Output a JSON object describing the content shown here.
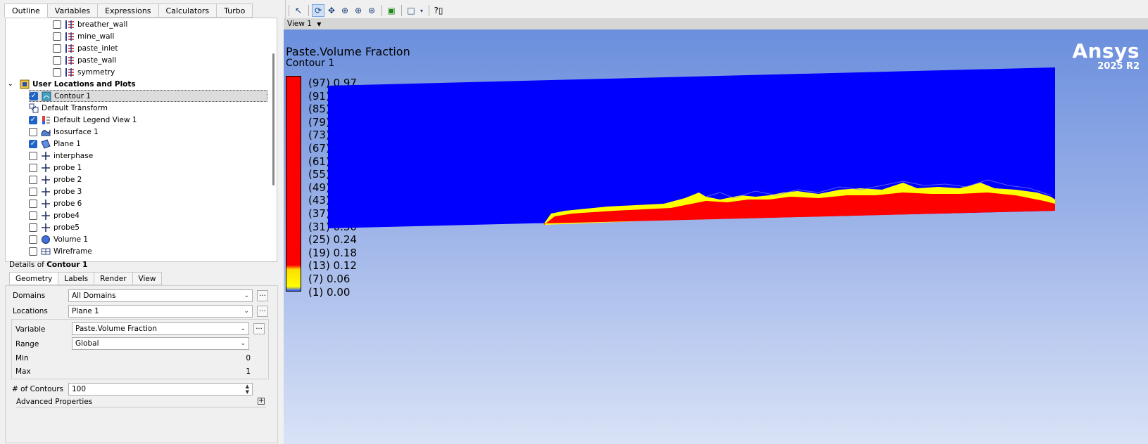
{
  "outline_tabs": [
    "Outline",
    "Variables",
    "Expressions",
    "Calculators",
    "Turbo"
  ],
  "tree": {
    "boundaries": [
      "breather_wall",
      "mine_wall",
      "paste_inlet",
      "paste_wall",
      "symmetry"
    ],
    "group_label": "User Locations and Plots",
    "items": [
      {
        "label": "Contour 1",
        "checked": true
      },
      {
        "label": "Default Transform",
        "checked": null
      },
      {
        "label": "Default Legend View 1",
        "checked": true
      },
      {
        "label": "Isosurface 1",
        "checked": false
      },
      {
        "label": "Plane 1",
        "checked": true
      },
      {
        "label": "interphase",
        "checked": false
      },
      {
        "label": "probe 1",
        "checked": false
      },
      {
        "label": "probe 2",
        "checked": false
      },
      {
        "label": "probe 3",
        "checked": false
      },
      {
        "label": "probe 6",
        "checked": false
      },
      {
        "label": "probe4",
        "checked": false
      },
      {
        "label": "probe5",
        "checked": false
      },
      {
        "label": "Volume 1",
        "checked": false
      },
      {
        "label": "Wireframe",
        "checked": false
      }
    ]
  },
  "details": {
    "title_prefix": "Details of",
    "title_object": "Contour 1",
    "tabs": [
      "Geometry",
      "Labels",
      "Render",
      "View"
    ],
    "domains_label": "Domains",
    "domains_value": "All Domains",
    "locations_label": "Locations",
    "locations_value": "Plane 1",
    "variable_label": "Variable",
    "variable_value": "Paste.Volume Fraction",
    "range_label": "Range",
    "range_value": "Global",
    "min_label": "Min",
    "min_value": "0",
    "max_label": "Max",
    "max_value": "1",
    "contours_label": "# of Contours",
    "contours_value": "100",
    "advanced_label": "Advanced Properties",
    "dots": "..."
  },
  "viewer": {
    "view_label": "View 1",
    "title": "Paste.Volume Fraction",
    "subtitle": "Contour 1",
    "legend": [
      "(97) 0.97",
      "(91) 0.91",
      "(85) 0.85",
      "(79) 0.79",
      "(73) 0.73",
      "(67) 0.67",
      "(61) 0.61",
      "(55) 0.55",
      "(49) 0.48",
      "(43) 0.42",
      "(37) 0.36",
      "(31) 0.30",
      "(25) 0.24",
      "(19) 0.18",
      "(13) 0.12",
      "(7) 0.06",
      "(1) 0.00"
    ],
    "logo": "Ansys",
    "version": "2025 R2"
  },
  "colors": {
    "domain_blue": "#0000ff",
    "paste_red": "#ff0000",
    "interface_yellow": "#ffff00"
  }
}
